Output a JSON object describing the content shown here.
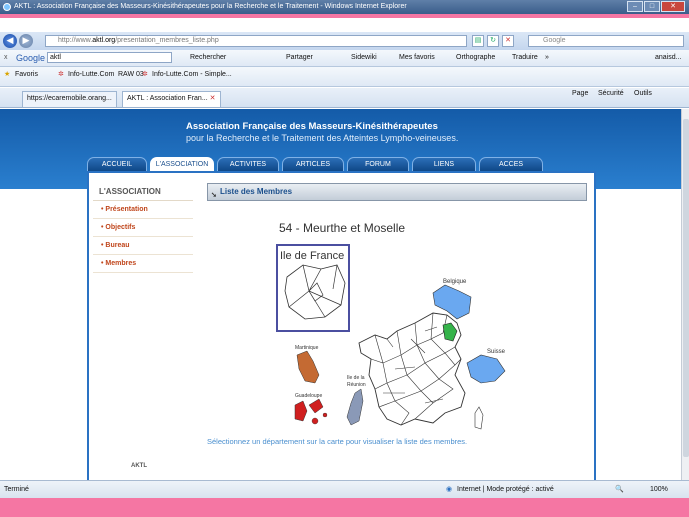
{
  "window": {
    "title": "AKTL : Association Française des Masseurs-Kinésithérapeutes pour la Recherche et le Traitement - Windows Internet Explorer"
  },
  "address": {
    "url_prefix": "http://www.",
    "url_domain": "aktl.org",
    "url_path": "/presentation_membres_liste.php",
    "search_placeholder": "Google"
  },
  "google_toolbar": {
    "close": "x",
    "brand": "Google",
    "query": "aktl",
    "items": [
      "Rechercher",
      "Partager",
      "Sidewiki",
      "Mes favoris",
      "Orthographe",
      "Traduire",
      "»",
      "anaisd..."
    ]
  },
  "favorites_bar": {
    "label": "Favoris",
    "items": [
      "Info-Lutte.Com",
      "RAW 03",
      "Info-Lutte.Com - Simple..."
    ]
  },
  "tabs": {
    "items": [
      "https://ecaremobile.orang...",
      "AKTL : Association Fran..."
    ],
    "commands": [
      "Page",
      "Sécurité",
      "Outils"
    ]
  },
  "site": {
    "title": "Association Française des Masseurs-Kinésithérapeutes",
    "subtitle": "pour la Recherche et le Traitement des Atteintes Lympho-veineuses.",
    "nav": [
      "ACCUEIL",
      "L'ASSOCIATION",
      "ACTIVITES",
      "ARTICLES",
      "FORUM",
      "LIENS",
      "ACCES RESERVES"
    ]
  },
  "sidebar": {
    "heading": "L'ASSOCIATION",
    "items": [
      "Présentation",
      "Objectifs",
      "Bureau",
      "Membres"
    ],
    "footer": "AKTL"
  },
  "panel": {
    "heading": "Liste des Membres",
    "department": "54 - Meurthe et Moselle",
    "map_labels": {
      "idf": "Ile de France",
      "belgique": "Belgique",
      "suisse": "Suisse",
      "martinique": "Martinique",
      "reunion_1": "Ile de la",
      "reunion_2": "Réunion",
      "guadeloupe": "Guadeloupe"
    },
    "instruction": "Sélectionnez un département sur la carte pour visualiser la liste des membres."
  },
  "status": {
    "left": "Terminé",
    "zone": "Internet | Mode protégé : activé",
    "zoom": "100%"
  },
  "colors": {
    "header_blue": "#1a5fae",
    "selected_dept": "#35b34a",
    "neighbor_countries": "#6aa8f0",
    "martinique": "#c46a33",
    "guadeloupe": "#d01f1f",
    "reunion": "#8a99b7",
    "side_link": "#c0461c"
  }
}
